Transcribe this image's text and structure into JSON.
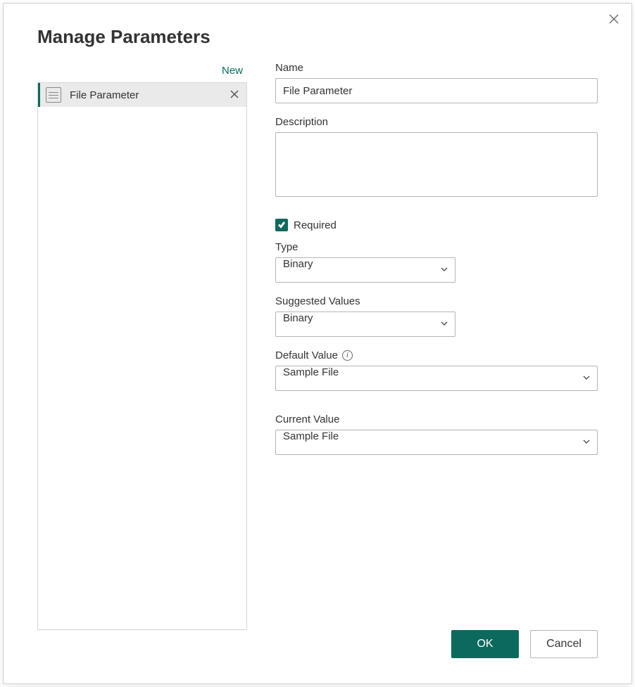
{
  "dialog": {
    "title": "Manage Parameters",
    "close_label": "Close"
  },
  "sidebar": {
    "new_label": "New",
    "items": [
      {
        "label": "File Parameter"
      }
    ]
  },
  "form": {
    "name": {
      "label": "Name",
      "value": "File Parameter"
    },
    "description": {
      "label": "Description",
      "value": ""
    },
    "required": {
      "label": "Required",
      "checked": true
    },
    "type": {
      "label": "Type",
      "value": "Binary"
    },
    "suggested_values": {
      "label": "Suggested Values",
      "value": "Binary"
    },
    "default_value": {
      "label": "Default Value",
      "value": "Sample File"
    },
    "current_value": {
      "label": "Current Value",
      "value": "Sample File"
    }
  },
  "footer": {
    "ok_label": "OK",
    "cancel_label": "Cancel"
  }
}
